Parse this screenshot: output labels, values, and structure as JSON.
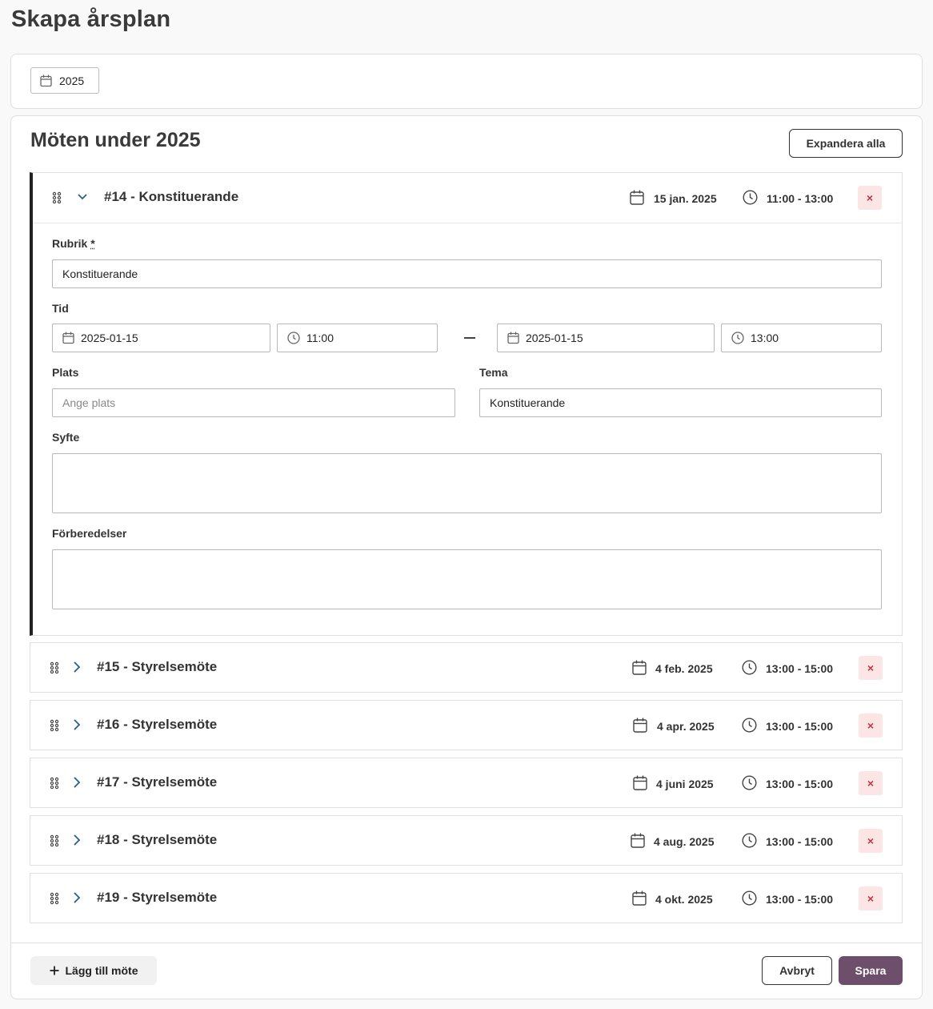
{
  "page": {
    "title": "Skapa årsplan"
  },
  "year_picker": {
    "value": "2025",
    "icon": "calendar-icon"
  },
  "meetings_section": {
    "title": "Möten under 2025",
    "expand_all_label": "Expandera alla"
  },
  "meetings": [
    {
      "title": "#14 - Konstituerande",
      "date": "15 jan. 2025",
      "time": "11:00 - 13:00",
      "expanded": true
    },
    {
      "title": "#15 - Styrelsemöte",
      "date": "4 feb. 2025",
      "time": "13:00 - 15:00",
      "expanded": false
    },
    {
      "title": "#16 - Styrelsemöte",
      "date": "4 apr. 2025",
      "time": "13:00 - 15:00",
      "expanded": false
    },
    {
      "title": "#17 - Styrelsemöte",
      "date": "4 juni 2025",
      "time": "13:00 - 15:00",
      "expanded": false
    },
    {
      "title": "#18 - Styrelsemöte",
      "date": "4 aug. 2025",
      "time": "13:00 - 15:00",
      "expanded": false
    },
    {
      "title": "#19 - Styrelsemöte",
      "date": "4 okt. 2025",
      "time": "13:00 - 15:00",
      "expanded": false
    }
  ],
  "form": {
    "rubrik_label": "Rubrik",
    "rubrik_required_mark": "*",
    "rubrik_value": "Konstituerande",
    "tid_label": "Tid",
    "start_date": "2025-01-15",
    "start_time": "11:00",
    "end_date": "2025-01-15",
    "end_time": "13:00",
    "plats_label": "Plats",
    "plats_placeholder": "Ange plats",
    "tema_label": "Tema",
    "tema_value": "Konstituerande",
    "syfte_label": "Syfte",
    "syfte_value": "",
    "forberedelser_label": "Förberedelser",
    "forberedelser_value": ""
  },
  "footer": {
    "add_label": "Lägg till möte",
    "cancel_label": "Avbryt",
    "save_label": "Spara"
  },
  "delete_glyph": "×",
  "colors": {
    "accent": "#6d4f6b",
    "delete_bg": "#fbe5e5",
    "delete_fg": "#c0354a",
    "chevron": "#2b5f8f"
  }
}
